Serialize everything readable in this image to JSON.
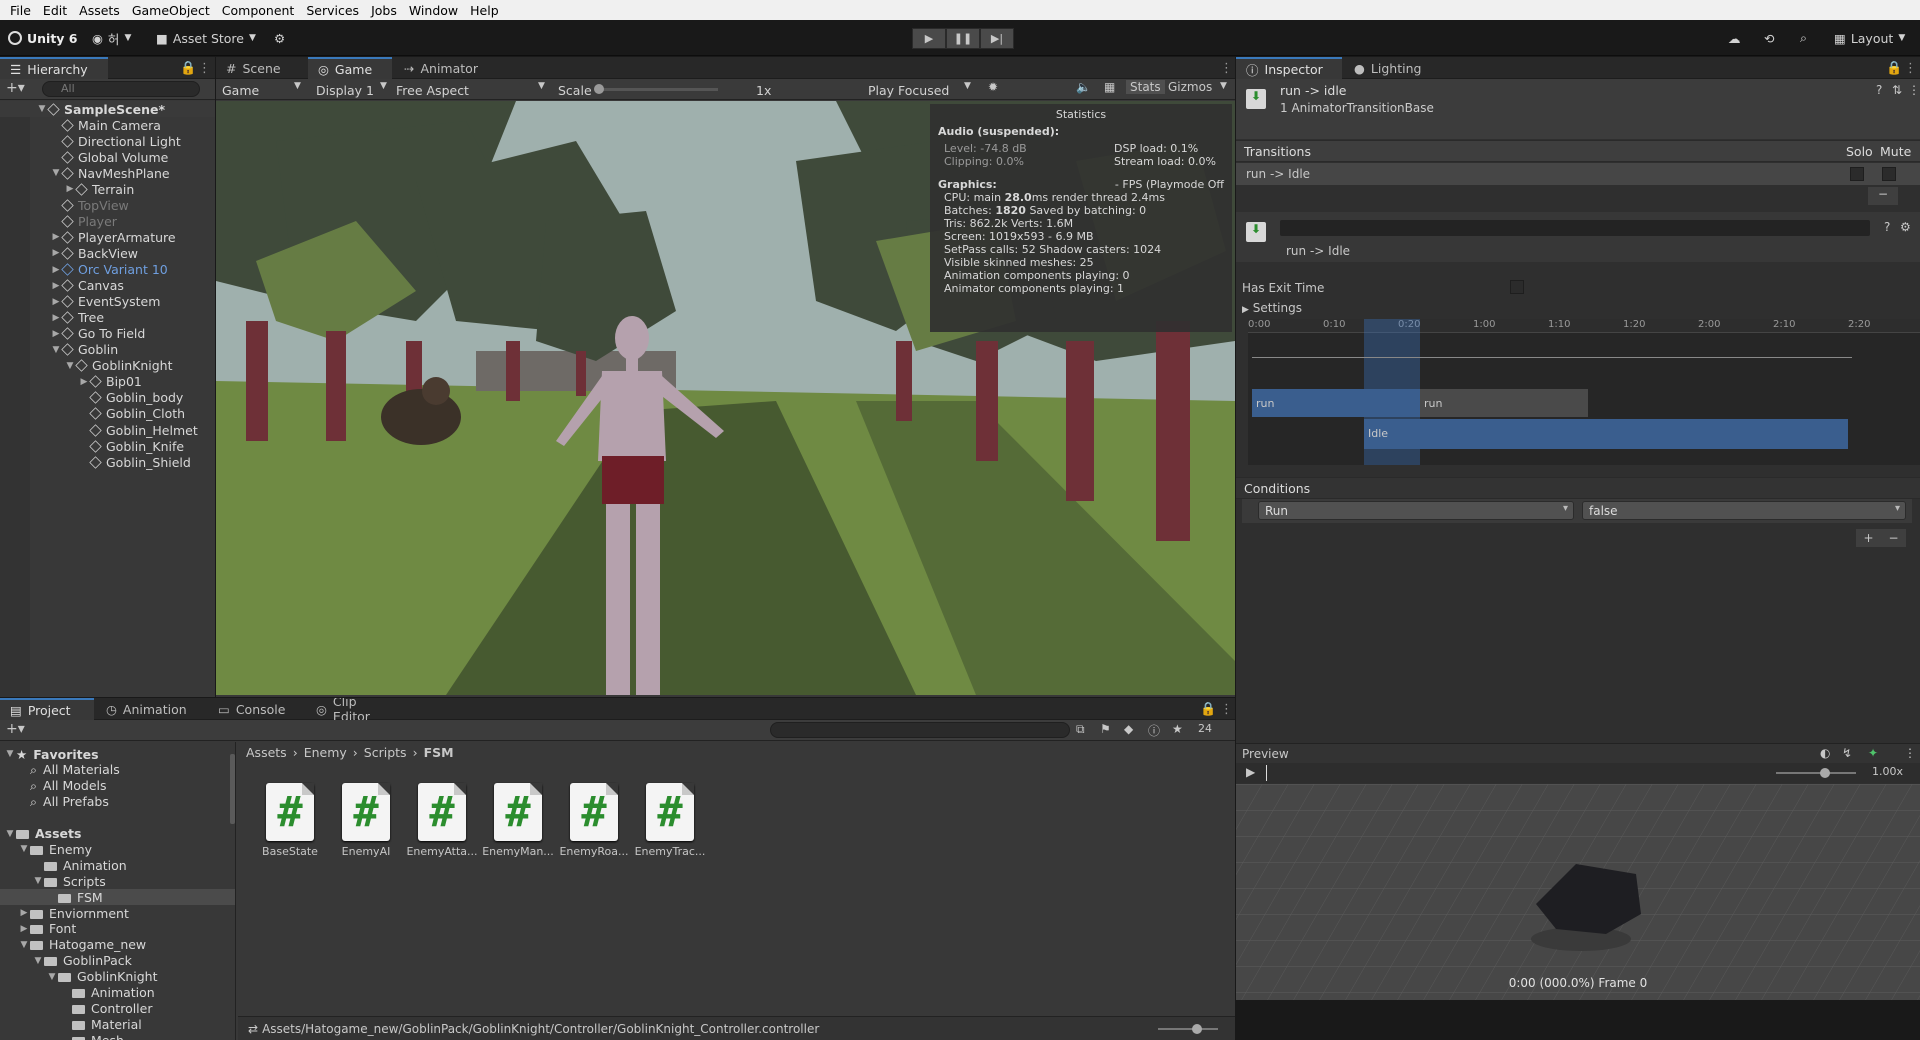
{
  "menu": [
    "File",
    "Edit",
    "Assets",
    "GameObject",
    "Component",
    "Services",
    "Jobs",
    "Window",
    "Help"
  ],
  "toolbar": {
    "unity_label": "Unity 6",
    "account_label": "허",
    "asset_store": "Asset Store",
    "layout": "Layout"
  },
  "hierarchy": {
    "tab": "Hierarchy",
    "search_placeholder": "All",
    "items": [
      {
        "label": "SampleScene*"
      },
      {
        "label": "Main Camera"
      },
      {
        "label": "Directional Light"
      },
      {
        "label": "Global Volume"
      },
      {
        "label": "NavMeshPlane"
      },
      {
        "label": "Terrain"
      },
      {
        "label": "TopView"
      },
      {
        "label": "Player"
      },
      {
        "label": "PlayerArmature"
      },
      {
        "label": "BackView"
      },
      {
        "label": "Orc Variant 10"
      },
      {
        "label": "Canvas"
      },
      {
        "label": "EventSystem"
      },
      {
        "label": "Tree"
      },
      {
        "label": "Go To Field"
      },
      {
        "label": "Goblin"
      },
      {
        "label": "GoblinKnight"
      },
      {
        "label": "Bip01"
      },
      {
        "label": "Goblin_body"
      },
      {
        "label": "Goblin_Cloth"
      },
      {
        "label": "Goblin_Helmet"
      },
      {
        "label": "Goblin_Knife"
      },
      {
        "label": "Goblin_Shield"
      }
    ]
  },
  "viewtabs": {
    "scene": "Scene",
    "game": "Game",
    "animator": "Animator"
  },
  "gamebar": {
    "mode": "Game",
    "display": "Display 1",
    "aspect": "Free Aspect",
    "scale_label": "Scale",
    "scale_value": "1x",
    "play_focused": "Play Focused",
    "stats": "Stats",
    "gizmos": "Gizmos"
  },
  "stats": {
    "title": "Statistics",
    "audio_header": "Audio (suspended):",
    "level": "Level: -74.8 dB",
    "dsp": "DSP load: 0.1%",
    "clipping": "Clipping: 0.0%",
    "stream": "Stream load: 0.0%",
    "graphics_header": "Graphics:",
    "fps": "- FPS (Playmode Off",
    "cpu_a": "CPU: main ",
    "cpu_b": "28.0",
    "cpu_c": "ms  render thread 2.4ms",
    "batches_a": "Batches: ",
    "batches_b": "1820",
    "batches_c": "   Saved by batching: 0",
    "tris": "Tris: 862.2k       Verts: 1.6M",
    "screen": "Screen: 1019x593 - 6.9 MB",
    "setpass": "SetPass calls: 52       Shadow casters: 1024",
    "skinned": "Visible skinned meshes: 25",
    "anim_comp": "Animation components playing: 0",
    "animator_comp": "Animator components playing: 1"
  },
  "bottomtabs": {
    "project": "Project",
    "animation": "Animation",
    "console": "Console",
    "clip": "Clip Editor",
    "count": "24"
  },
  "project": {
    "favorites": "Favorites",
    "fav_items": [
      "All Materials",
      "All Models",
      "All Prefabs"
    ],
    "assets": "Assets",
    "tree": [
      "Enemy",
      "Animation",
      "Scripts",
      "FSM",
      "Enviornment",
      "Font",
      "Hatogame_new",
      "GoblinPack",
      "GoblinKnight",
      "Animation",
      "Controller",
      "Material",
      "Mesh"
    ],
    "breadcrumb": [
      "Assets",
      "Enemy",
      "Scripts",
      "FSM"
    ],
    "files": [
      "BaseState",
      "EnemyAI",
      "EnemyAtta...",
      "EnemyMan...",
      "EnemyRoa...",
      "EnemyTrac..."
    ],
    "status_path": "Assets/Hatogame_new/GoblinPack/GoblinKnight/Controller/GoblinKnight_Controller.controller"
  },
  "inspector": {
    "tab": "Inspector",
    "lighting": "Lighting",
    "title": "run -> idle",
    "subtitle": "1 AnimatorTransitionBase",
    "transitions": "Transitions",
    "solo": "Solo",
    "mute": "Mute",
    "transition_item": "run -> Idle",
    "detail_name": "run -> Idle",
    "has_exit": "Has Exit Time",
    "settings": "Settings",
    "ticks": [
      "0:00",
      "0:10",
      "0:20",
      "1:00",
      "1:10",
      "1:20",
      "2:00",
      "2:10",
      "2:20"
    ],
    "clip_run1": "run",
    "clip_run2": "run",
    "clip_idle": "Idle",
    "conditions": "Conditions",
    "cond_param": "Run",
    "cond_value": "false",
    "preview": "Preview",
    "speed": "1.00x",
    "frame": "0:00 (000.0%) Frame 0"
  },
  "colors": {
    "accent": "#3a79bb",
    "blue_clip": "#3a5e8e",
    "grass": "#6f8a43"
  }
}
